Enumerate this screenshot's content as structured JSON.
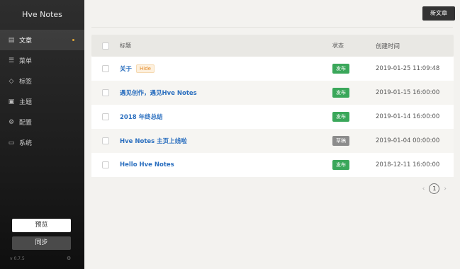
{
  "app": {
    "title": "Hve Notes",
    "version": "v 0.7.5"
  },
  "sidebar": {
    "items": [
      {
        "label": "文章",
        "icon": "document-icon"
      },
      {
        "label": "菜单",
        "icon": "list-icon"
      },
      {
        "label": "标签",
        "icon": "tag-icon"
      },
      {
        "label": "主题",
        "icon": "image-icon"
      },
      {
        "label": "配置",
        "icon": "gear-icon"
      },
      {
        "label": "系统",
        "icon": "monitor-icon"
      }
    ],
    "preview_label": "预览",
    "sync_label": "同步"
  },
  "toolbar": {
    "new_post_label": "新文章"
  },
  "table": {
    "columns": {
      "title": "标题",
      "status": "状态",
      "created": "创建时间"
    },
    "rows": [
      {
        "title": "关于",
        "tag": "Hide",
        "status": "发布",
        "created": "2019-01-25 11:09:48"
      },
      {
        "title": "遇见创作，遇见Hve Notes",
        "status": "发布",
        "created": "2019-01-15 16:00:00"
      },
      {
        "title": "2018 年终总结",
        "status": "发布",
        "created": "2019-01-14 16:00:00"
      },
      {
        "title": "Hve Notes 主页上线啦",
        "status": "草稿",
        "created": "2019-01-04 00:00:00"
      },
      {
        "title": "Hello Hve Notes",
        "status": "发布",
        "created": "2018-12-11 16:00:00"
      }
    ]
  },
  "pagination": {
    "current_page": "1"
  },
  "colors": {
    "published": "#3aa75a",
    "draft": "#8c8c8c",
    "link": "#2b6fbf",
    "active_dot": "#e0a836"
  }
}
